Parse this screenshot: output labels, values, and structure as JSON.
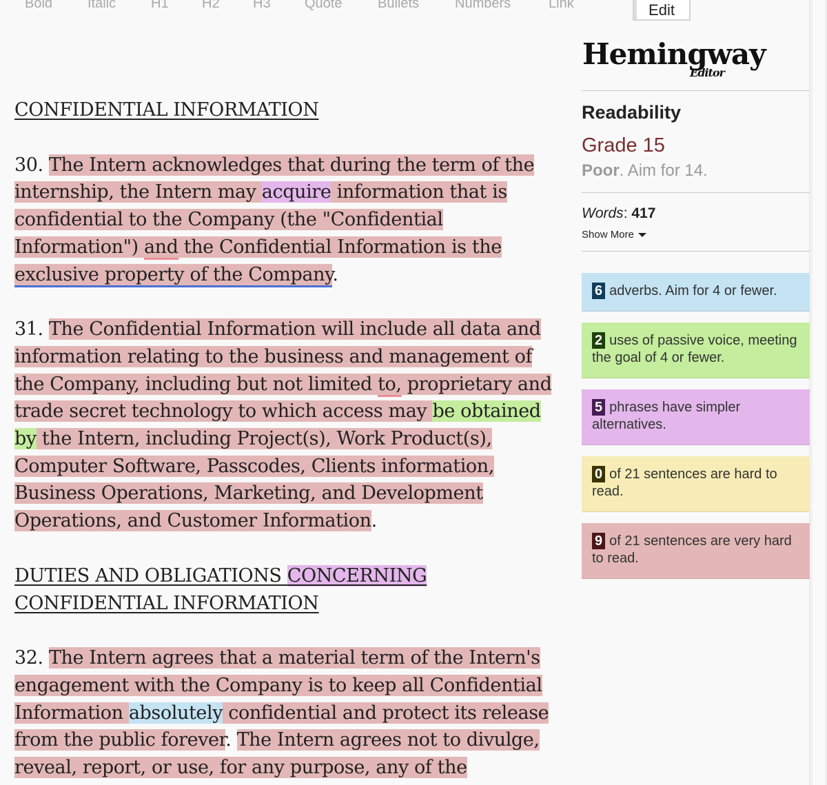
{
  "toolbar": {
    "bold": "Bold",
    "italic": "Italic",
    "h1": "H1",
    "h2": "H2",
    "h3": "H3",
    "quote": "Quote",
    "bullets": "Bullets",
    "numbers": "Numbers",
    "link": "Link",
    "edit": "Edit"
  },
  "doc": {
    "h_confidential": "CONFIDENTIAL INFORMATION",
    "p30": {
      "num": "30. ",
      "s1a": "The Intern acknowledges that during the term of the internship, the Intern may ",
      "s1b": "acquire",
      "s1c": " information that is confidential to the Company (the \"Confidential Information\") ",
      "s1d": "and",
      "s1e": " the Confidential Information is the ",
      "s1f": "exclusive property of the Company",
      "end": "."
    },
    "p31": {
      "num": "31. ",
      "s1a": "The Confidential Information will include all data and information relating to the business and management of the Company, including but not limited ",
      "s1b": "to,",
      "s1c": " proprietary and trade secret technology to which access may ",
      "s1d": "be obtained by",
      "s1e": " the Intern, including Project(s), Work Product(s), Computer Software, Passcodes, Clients information, Business Operations, Marketing, and Development Operations, and Customer Information",
      "end": "."
    },
    "h_duties_a": "DUTIES AND OBLIGATIONS ",
    "h_duties_b": "CONCERNING",
    "h_duties_c": " CONFIDENTIAL INFORMATION",
    "p32": {
      "num": "32. ",
      "s1a": "The Intern agrees that a material term of the Intern's engagement with the Company is to keep all Confidential Information ",
      "s1b": "absolutely",
      "s1c": " confidential and protect its release from the public forever",
      "s1d": ". ",
      "s2": "The Intern agrees not to divulge, reveal, report, or use, for any purpose, any of the"
    }
  },
  "sidebar": {
    "logo_main": "Hemingway",
    "logo_sub": "Editor",
    "readability_label": "Readability",
    "grade": "Grade 15",
    "grade_status": "Poor",
    "grade_aim": ". Aim for 14.",
    "words_label": "Words",
    "words_sep": ": ",
    "words_count": "417",
    "show_more": "Show More",
    "cards": [
      {
        "count": "6",
        "text": "adverbs. Aim for 4 or fewer.",
        "color": "#c4e3f3"
      },
      {
        "count": "2",
        "text": "uses of passive voice, meeting the goal of 4 or fewer.",
        "color": "#c4ed9d"
      },
      {
        "count": "5",
        "text": "phrases have simpler alternatives.",
        "color": "#e3b7eb"
      },
      {
        "count": "0",
        "text": "of 21 sentences are hard to read.",
        "color": "#f7ecb5"
      },
      {
        "count": "9",
        "text": "of 21 sentences are very hard to read.",
        "color": "#e3b7b7"
      }
    ]
  }
}
